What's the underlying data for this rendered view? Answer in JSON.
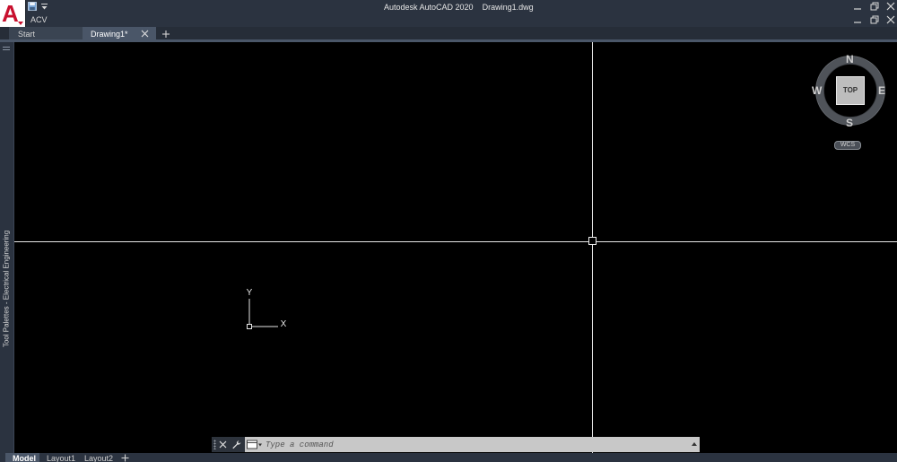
{
  "titlebar": {
    "app_icon": "autocad-a-icon",
    "workspace_label": "ACV",
    "window_title": "Autodesk AutoCAD 2020    Drawing1.dwg",
    "controls": [
      "minimize-icon",
      "restore-icon",
      "close-icon"
    ]
  },
  "file_tabs": {
    "items": [
      {
        "label": "Start"
      },
      {
        "label": "Drawing1*"
      }
    ],
    "active": "Drawing1*"
  },
  "tool_palette": {
    "title": "Tool Palettes - Electrical Engineering"
  },
  "ucs": {
    "x_label": "X",
    "y_label": "Y"
  },
  "viewcube": {
    "north": "N",
    "south": "S",
    "east": "E",
    "west": "W",
    "face": "TOP",
    "wcs_label": "WCS"
  },
  "command_line": {
    "placeholder": "Type a command"
  },
  "layout_tabs": {
    "items": [
      {
        "label": "Model"
      },
      {
        "label": "Layout1"
      },
      {
        "label": "Layout2"
      }
    ],
    "active": "Model"
  },
  "colors": {
    "chrome": "#2b3340",
    "canvas": "#000000",
    "crosshair": "#e8e8e8",
    "command_bar": "#c8c8c8",
    "brand_red": "#c8102e"
  }
}
